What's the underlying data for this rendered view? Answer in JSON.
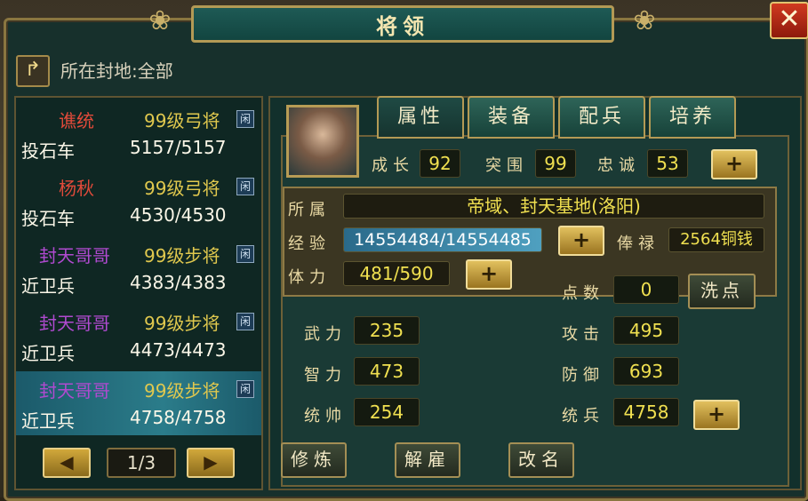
{
  "window": {
    "title": "将领",
    "close_label": "✕"
  },
  "location": {
    "text": "所在封地:全部",
    "back_icon": "arrow-return-icon"
  },
  "generals": [
    {
      "name": "谯统",
      "name_color": "#e04a3a",
      "level": "99级弓将",
      "status": "闲",
      "unit": "投石车",
      "troops": "5157/5157"
    },
    {
      "name": "杨秋",
      "name_color": "#e04a3a",
      "level": "99级弓将",
      "status": "闲",
      "unit": "投石车",
      "troops": "4530/4530"
    },
    {
      "name": "封天哥哥",
      "name_color": "#b04ad0",
      "level": "99级步将",
      "status": "闲",
      "unit": "近卫兵",
      "troops": "4383/4383"
    },
    {
      "name": "封天哥哥",
      "name_color": "#b04ad0",
      "level": "99级步将",
      "status": "闲",
      "unit": "近卫兵",
      "troops": "4473/4473"
    },
    {
      "name": "封天哥哥",
      "name_color": "#b04ad0",
      "level": "99级步将",
      "status": "闲",
      "unit": "近卫兵",
      "troops": "4758/4758"
    }
  ],
  "pager": {
    "prev": "◀",
    "page": "1/3",
    "next": "▶"
  },
  "tabs": [
    {
      "label": "属性"
    },
    {
      "label": "装备"
    },
    {
      "label": "配兵"
    },
    {
      "label": "培养"
    }
  ],
  "growth": {
    "items": [
      {
        "label": "成长",
        "value": "92"
      },
      {
        "label": "突围",
        "value": "99"
      },
      {
        "label": "忠诚",
        "value": "53"
      }
    ],
    "plus": "+"
  },
  "info": {
    "affiliation_label": "所属",
    "affiliation": "帝域、封天基地(洛阳)",
    "exp_label": "经验",
    "exp": "14554484/14554485",
    "salary_label": "俸禄",
    "salary": "2564铜钱",
    "stamina_label": "体力",
    "stamina": "481/590",
    "plus": "+"
  },
  "points": {
    "label": "点数",
    "value": "0",
    "wash_label": "洗点"
  },
  "stats": {
    "wuli_label": "武力",
    "wuli": "235",
    "zhili_label": "智力",
    "zhili": "473",
    "tongshuai_label": "统帅",
    "tongshuai": "254",
    "gongji_label": "攻击",
    "gongji": "495",
    "fangyu_label": "防御",
    "fangyu": "693",
    "tongbing_label": "统兵",
    "tongbing": "4758",
    "plus": "+"
  },
  "actions": {
    "train": "修炼",
    "dismiss": "解雇",
    "rename": "改名"
  }
}
